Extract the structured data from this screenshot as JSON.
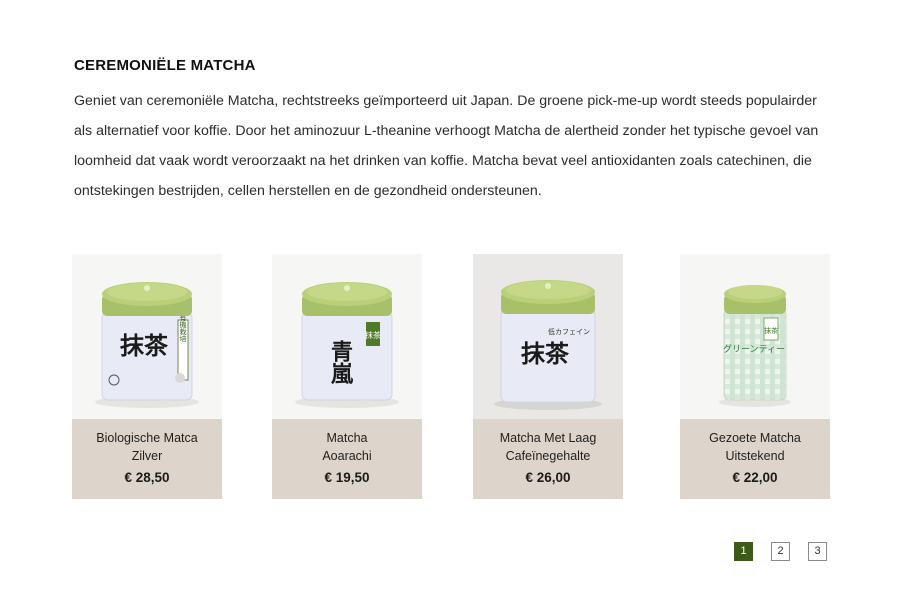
{
  "section": {
    "title": "CEREMONIËLE MATCHA",
    "description": "Geniet van ceremoniële Matcha, rechtstreeks geïmporteerd uit Japan. De groene pick-me-up wordt steeds populairder als alternatief voor koffie. Door het aminozuur L-theanine verhoogt Matcha de alertheid zonder het typische gevoel van loomheid dat vaak wordt veroorzaakt na het drinken van koffie. Matcha bevat veel antioxidanten zoals catechinen, die ontstekingen bestrijden, cellen herstellen en de gezondheid ondersteunen."
  },
  "products": [
    {
      "name": "Biologische Matca\nZilver",
      "price": "€ 28,50",
      "image_icon": "matcha-tin-organic",
      "label_text": "抹茶",
      "side_text": "有機栽培"
    },
    {
      "name": "Matcha\nAoarachi",
      "price": "€ 19,50",
      "image_icon": "matcha-tin-aoarashi",
      "label_text": "青嵐",
      "side_text": "抹茶"
    },
    {
      "name": "Matcha Met Laag\nCafeïnegehalte",
      "price": "€ 26,00",
      "image_icon": "matcha-tin-low-caffeine",
      "label_text": "抹茶",
      "side_text": "低カフェイン"
    },
    {
      "name": "Gezoete Matcha\nUitstekend",
      "price": "€ 22,00",
      "image_icon": "matcha-tin-sweetened",
      "label_text": "グリーンティー",
      "side_text": "抹茶"
    }
  ],
  "pagination": {
    "pages": [
      "1",
      "2",
      "3"
    ],
    "active": "1"
  },
  "colors": {
    "card_info_bg": "#ddd5cb",
    "pagination_active": "#3d5a16",
    "tin_lid": "#a9c06a"
  }
}
